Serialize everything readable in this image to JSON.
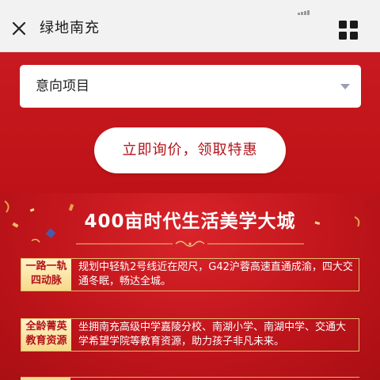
{
  "header": {
    "title": "绿地南充",
    "close_icon": "close-icon",
    "menu_icon": "grid-menu-icon"
  },
  "form": {
    "select_value": "意向项目",
    "cta_label": "立即询价，领取特惠"
  },
  "promo": {
    "title": "400亩时代生活美学大城",
    "features": [
      {
        "label_line1": "一路一轨",
        "label_line2": "四动脉",
        "text": "规划中轻轨2号线近在咫尺，G42沪蓉高速直通成渝，四大交通冬眠，畅达全城。"
      },
      {
        "label_line1": "全龄菁英",
        "label_line2": "教育资源",
        "text": "坐拥南充高级中学嘉陵分校、南湖小学、南湖中学、交通大学希望学院等教育资源，助力孩子非凡未来。"
      }
    ]
  },
  "colors": {
    "brand_red": "#c4161c",
    "gold": "#f6d98a",
    "cta_text": "#b3131a"
  }
}
